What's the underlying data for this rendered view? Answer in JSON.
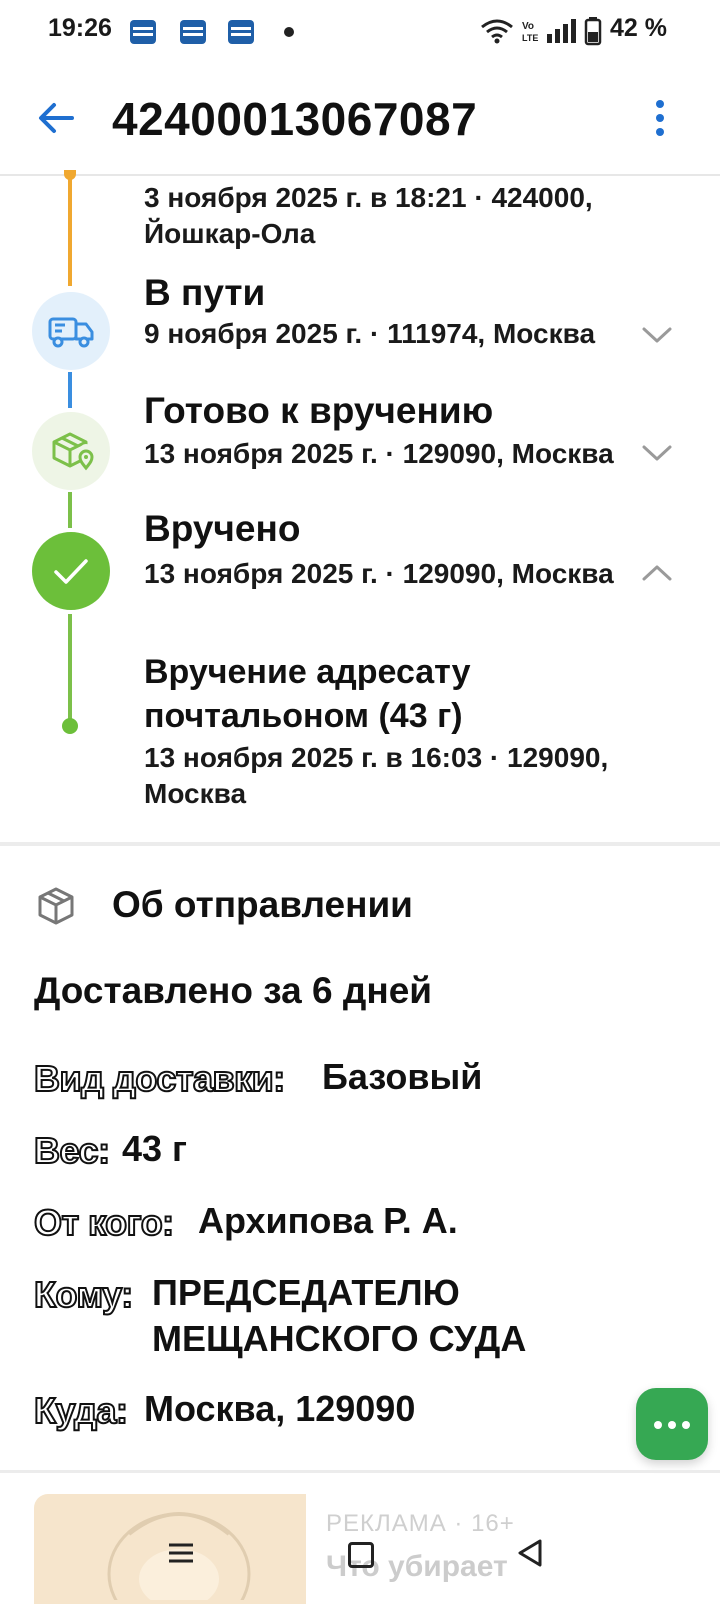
{
  "status_bar": {
    "time": "19:26",
    "battery": "42 %",
    "notification_icons": [
      "news-app-icon",
      "news-app-icon",
      "news-app-icon"
    ]
  },
  "header": {
    "title": "42400013067087",
    "back_icon": "arrow-left-icon",
    "menu_icon": "more-vert-icon"
  },
  "timeline": {
    "events": [
      {
        "title": "",
        "meta": "3 ноября 2025 г. в 18:21 · 424000, Йошкар-Ола",
        "color": "#f0a830"
      },
      {
        "title": "В пути",
        "meta": "9 ноября 2025 г. · 111974, Москва",
        "icon": "truck-icon",
        "expanded": false
      },
      {
        "title": "Готово к вручению",
        "meta": "13 ноября 2025 г. · 129090, Москва",
        "icon": "package-location-icon",
        "expanded": false
      },
      {
        "title": "Вручено",
        "meta": "13 ноября 2025 г. · 129090, Москва",
        "icon": "check-icon",
        "expanded": true
      }
    ],
    "detail": {
      "title": "Вручение адресату почтальоном (43 г)",
      "meta": "13 ноября 2025 г. в 16:03 · 129090, Москва"
    }
  },
  "about": {
    "title": "Об отправлении",
    "delivered": "Доставлено за 6 дней",
    "rows": [
      {
        "label": "Вид доставки:",
        "value": "Базовый"
      },
      {
        "label": "Вес:",
        "value": "43 г"
      },
      {
        "label": "От кого:",
        "value": "Архипова Р. А."
      },
      {
        "label": "Кому:",
        "value": "ПРЕДСЕДАТЕЛЮ МЕЩАНСКОГО СУДА"
      },
      {
        "label": "Куда:",
        "value": "Москва, 129090"
      }
    ]
  },
  "ad": {
    "label": "РЕКЛАМА · 16+",
    "headline": "Что убирает"
  },
  "colors": {
    "accent_blue": "#1f6fd0",
    "success_green": "#6cbf3a",
    "fab_green": "#36a853",
    "orange": "#f0a830"
  }
}
